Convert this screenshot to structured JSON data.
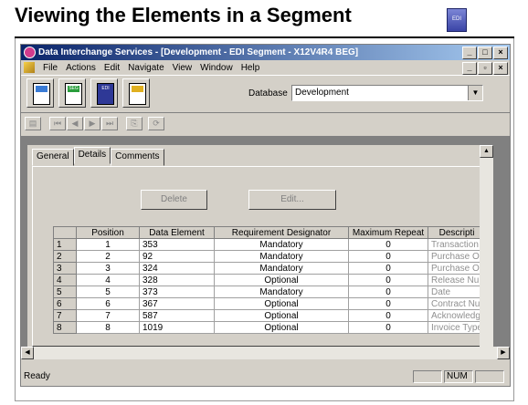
{
  "slide": {
    "title": "Viewing the Elements in a Segment",
    "icon": "EDI"
  },
  "window": {
    "title": "Data Interchange Services - [Development - EDI Segment - X12V4R4  BEG]"
  },
  "menu": [
    "File",
    "Actions",
    "Edit",
    "Navigate",
    "View",
    "Window",
    "Help"
  ],
  "toolbar": {
    "badges": [
      "",
      "SEG",
      "EDI",
      ""
    ],
    "database_label": "Database",
    "database_value": "Development"
  },
  "tabs": [
    "General",
    "Details",
    "Comments"
  ],
  "buttons": {
    "delete": "Delete",
    "edit": "Edit..."
  },
  "table": {
    "columns": [
      "Position",
      "Data Element",
      "Requirement Designator",
      "Maximum Repeat",
      "Descripti"
    ],
    "rows": [
      {
        "n": "1",
        "pos": "1",
        "elem": "353",
        "req": "Mandatory",
        "max": "0",
        "desc": "Transaction"
      },
      {
        "n": "2",
        "pos": "2",
        "elem": "92",
        "req": "Mandatory",
        "max": "0",
        "desc": "Purchase Or"
      },
      {
        "n": "3",
        "pos": "3",
        "elem": "324",
        "req": "Mandatory",
        "max": "0",
        "desc": "Purchase Or"
      },
      {
        "n": "4",
        "pos": "4",
        "elem": "328",
        "req": "Optional",
        "max": "0",
        "desc": "Release Nu"
      },
      {
        "n": "5",
        "pos": "5",
        "elem": "373",
        "req": "Mandatory",
        "max": "0",
        "desc": "Date"
      },
      {
        "n": "6",
        "pos": "6",
        "elem": "367",
        "req": "Optional",
        "max": "0",
        "desc": "Contract Nu"
      },
      {
        "n": "7",
        "pos": "7",
        "elem": "587",
        "req": "Optional",
        "max": "0",
        "desc": "Acknowledg"
      },
      {
        "n": "8",
        "pos": "8",
        "elem": "1019",
        "req": "Optional",
        "max": "0",
        "desc": "Invoice Type"
      }
    ]
  },
  "status": {
    "text": "Ready",
    "num": "NUM"
  },
  "colors": {
    "titlebar": "#0a246a",
    "face": "#d4d0c8"
  }
}
